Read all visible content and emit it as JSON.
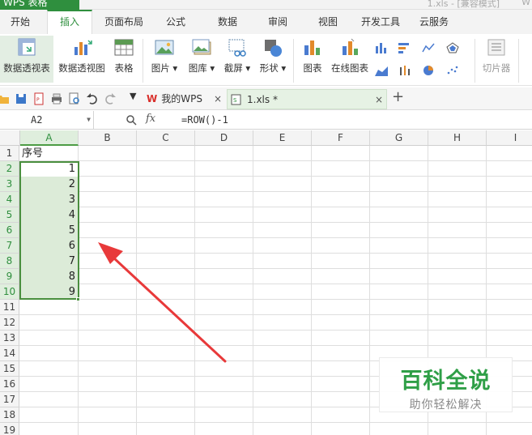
{
  "titlebar": {
    "app_name": "WPS 表格",
    "file_info": "1.xls - [兼容模式]",
    "right_text": "W"
  },
  "menu_tabs": [
    "开始",
    "插入",
    "页面布局",
    "公式",
    "数据",
    "审阅",
    "视图",
    "开发工具",
    "云服务"
  ],
  "active_tab": "插入",
  "ribbon": {
    "pivot_table": "数据透视表",
    "pivot_chart": "数据透视图",
    "table": "表格",
    "picture": "图片",
    "gallery": "图库",
    "screenshot": "截屏",
    "shapes": "形状",
    "chart": "图表",
    "online_chart": "在线图表",
    "slicer": "切片器"
  },
  "doc_tabs": [
    {
      "label": "我的WPS",
      "close": "×"
    },
    {
      "label": "1.xls *",
      "close": "×"
    }
  ],
  "new_tab": "+",
  "formula_bar": {
    "cell_ref": "A2",
    "fx": "fx",
    "formula": "=ROW()-1"
  },
  "columns": [
    "A",
    "B",
    "C",
    "D",
    "E",
    "F",
    "G",
    "H",
    "I"
  ],
  "rows": [
    "1",
    "2",
    "3",
    "4",
    "5",
    "6",
    "7",
    "8",
    "9",
    "10",
    "11",
    "12",
    "13",
    "14",
    "15",
    "16",
    "17",
    "18",
    "19"
  ],
  "cells": {
    "A1": "序号",
    "A2": "1",
    "A3": "2",
    "A4": "3",
    "A5": "4",
    "A6": "5",
    "A7": "6",
    "A8": "7",
    "A9": "8",
    "A10": "9"
  },
  "watermark": {
    "title": "百科全说",
    "subtitle": "助你轻松解决"
  },
  "colors": {
    "accent": "#2f8f3e",
    "arrow": "#e8393a",
    "selection": "#dcebd8"
  }
}
